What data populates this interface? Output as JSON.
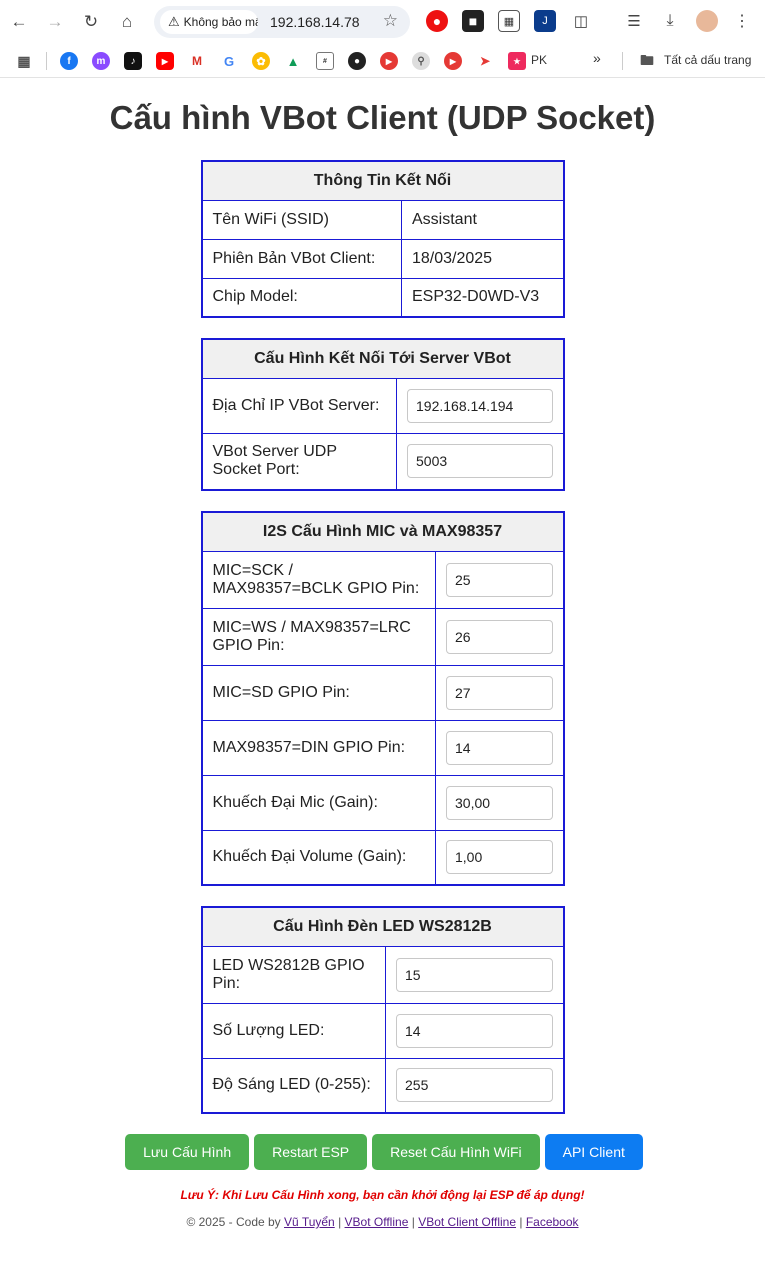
{
  "browser": {
    "security_label": "Không bảo mật",
    "url": "192.168.14.78",
    "bookmark_pk": "PK",
    "bookmark_all": "Tất cả dấu trang"
  },
  "title": "Cấu hình VBot Client (UDP Socket)",
  "connection_info": {
    "header": "Thông Tin Kết Nối",
    "rows": [
      {
        "label": "Tên WiFi (SSID)",
        "value": "Assistant"
      },
      {
        "label": "Phiên Bản VBot Client:",
        "value": "18/03/2025"
      },
      {
        "label": "Chip Model:",
        "value": "ESP32-D0WD-V3"
      }
    ]
  },
  "server_config": {
    "header": "Cấu Hình Kết Nối Tới Server VBot",
    "rows": [
      {
        "label": "Địa Chỉ IP VBot Server:",
        "value": "192.168.14.194"
      },
      {
        "label": "VBot Server UDP Socket Port:",
        "value": "5003"
      }
    ]
  },
  "i2s_config": {
    "header": "I2S Cấu Hình MIC và MAX98357",
    "rows": [
      {
        "label": "MIC=SCK / MAX98357=BCLK GPIO Pin:",
        "value": "25"
      },
      {
        "label": "MIC=WS / MAX98357=LRC GPIO Pin:",
        "value": "26"
      },
      {
        "label": "MIC=SD GPIO Pin:",
        "value": "27"
      },
      {
        "label": "MAX98357=DIN GPIO Pin:",
        "value": "14"
      },
      {
        "label": "Khuếch Đại Mic (Gain):",
        "value": "30,00"
      },
      {
        "label": "Khuếch Đại Volume (Gain):",
        "value": "1,00"
      }
    ]
  },
  "led_config": {
    "header": "Cấu Hình Đèn LED WS2812B",
    "rows": [
      {
        "label": "LED WS2812B GPIO Pin:",
        "value": "15"
      },
      {
        "label": "Số Lượng LED:",
        "value": "14"
      },
      {
        "label": "Độ Sáng LED (0-255):",
        "value": "255"
      }
    ]
  },
  "buttons": {
    "save": "Lưu Cấu Hình",
    "restart": "Restart ESP",
    "reset_wifi": "Reset Cấu Hình WiFi",
    "api": "API Client"
  },
  "note": "Lưu Ý: Khi Lưu Cấu Hình xong, bạn cần khởi động lại ESP để áp dụng!",
  "footer": {
    "prefix": "© 2025 - Code by",
    "author": "Vũ Tuyển",
    "sep": "|",
    "link1": "VBot Offline",
    "link2": "VBot Client Offline",
    "link3": "Facebook"
  },
  "colors": {
    "table_border": "#1a1ad6",
    "button_green": "#4caf50",
    "button_blue": "#0d7cf2",
    "note_red": "#e00000"
  }
}
